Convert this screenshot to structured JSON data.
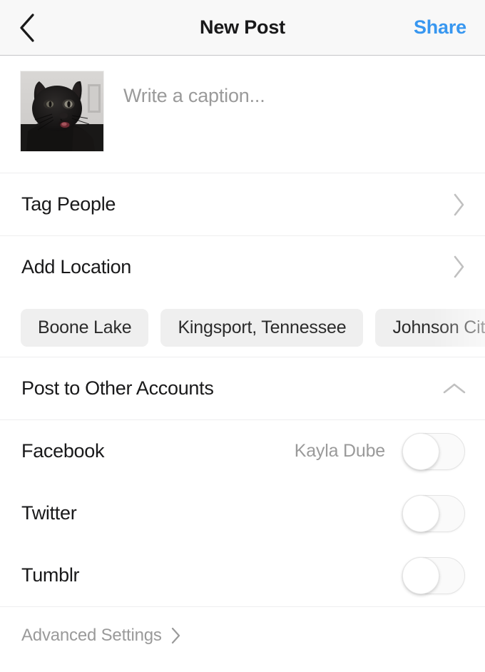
{
  "header": {
    "back_icon": "chevron-left-icon",
    "title": "New Post",
    "share_label": "Share"
  },
  "caption": {
    "placeholder": "Write a caption...",
    "value": "",
    "thumbnail_alt": "black-cat-photo"
  },
  "rows": {
    "tag_people": {
      "label": "Tag People",
      "chevron": "chevron-right-icon"
    },
    "add_location": {
      "label": "Add Location",
      "chevron": "chevron-right-icon"
    }
  },
  "location_suggestions": [
    {
      "label": "Boone Lake",
      "faded": false
    },
    {
      "label": "Kingsport, Tennessee",
      "faded": false
    },
    {
      "label": "Johnson City",
      "faded": true
    }
  ],
  "other_accounts": {
    "title": "Post to Other Accounts",
    "collapse_icon": "chevron-up-icon",
    "items": [
      {
        "name": "Facebook",
        "account": "Kayla Dube",
        "enabled": false,
        "toggle_icon": "toggle-off-icon"
      },
      {
        "name": "Twitter",
        "account": "",
        "enabled": false,
        "toggle_icon": "toggle-off-icon"
      },
      {
        "name": "Tumblr",
        "account": "",
        "enabled": false,
        "toggle_icon": "toggle-off-icon"
      }
    ]
  },
  "footer": {
    "advanced_settings_label": "Advanced Settings",
    "chevron": "chevron-right-icon"
  },
  "colors": {
    "accent": "#3897f0",
    "text": "#19191a",
    "muted": "#9a9a9a",
    "chip_bg": "#efefef",
    "header_bg": "#f8f8f8",
    "divider": "#eeeeef"
  }
}
